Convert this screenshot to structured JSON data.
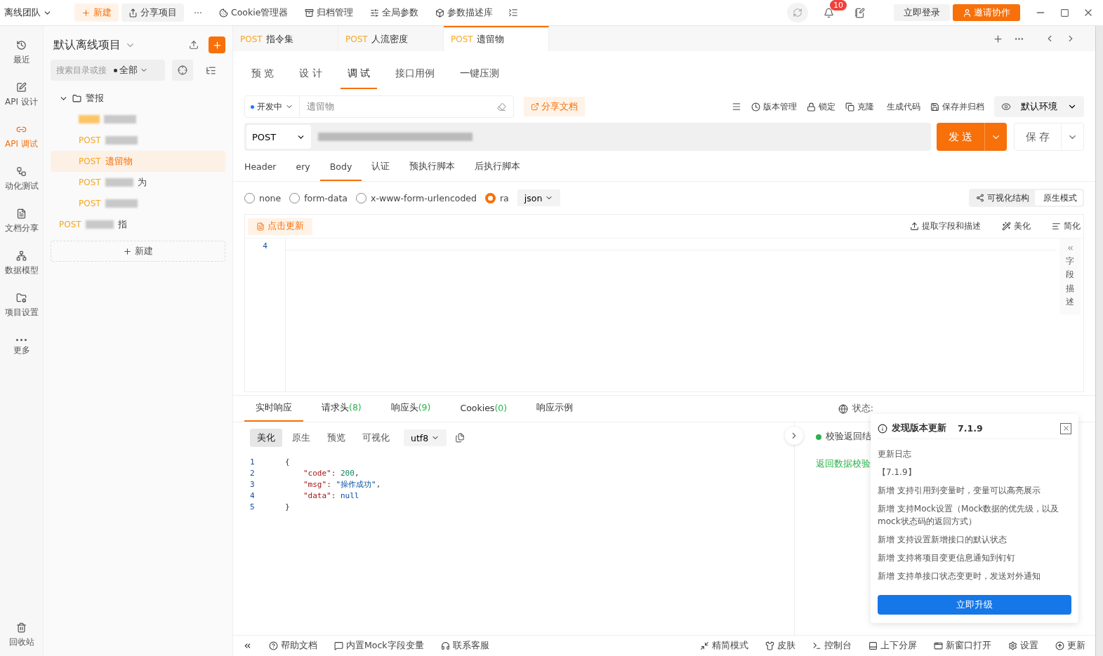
{
  "top_bar": {
    "team": "离线团队",
    "actions": [
      {
        "label": "新建",
        "kind": "primary"
      },
      {
        "label": "分享项目",
        "kind": "boxed"
      },
      {
        "label": "···",
        "kind": "plain"
      },
      {
        "label": "Cookie管理器",
        "kind": "plain"
      },
      {
        "label": "归档管理",
        "kind": "plain"
      },
      {
        "label": "全局参数",
        "kind": "plain"
      },
      {
        "label": "参数描述库",
        "kind": "plain"
      }
    ],
    "notification_count": "10",
    "login": "立即登录",
    "invite": "邀请协作"
  },
  "rail": {
    "items": [
      {
        "label": "最近",
        "selected": false
      },
      {
        "label": "API 设计",
        "selected": false
      },
      {
        "label": "API 调试",
        "selected": true
      },
      {
        "label": "动化测试",
        "selected": false
      },
      {
        "label": "文档分享",
        "selected": false
      },
      {
        "label": "数据模型",
        "selected": false
      },
      {
        "label": "项目设置",
        "selected": false
      },
      {
        "label": "更多",
        "selected": false
      }
    ],
    "bottom": "回收站"
  },
  "sidebar": {
    "title": "默认离线项目",
    "search_placeholder": "搜索目录或接",
    "filter": "全部",
    "tree": [
      {
        "name": "警报",
        "kind": "folder",
        "expanded": true,
        "children": [
          {
            "kind": "api",
            "blurred": true,
            "selected": false
          },
          {
            "kind": "api",
            "method": "POST",
            "blurred": true,
            "selected": false
          },
          {
            "kind": "api",
            "method": "POST",
            "name": "遗留物",
            "blurred": false,
            "selected": true
          },
          {
            "kind": "api",
            "method": "POST",
            "name": "为",
            "blurred": true,
            "selected": false
          },
          {
            "kind": "api",
            "method": "POST",
            "blurred": true,
            "selected": false
          }
        ]
      },
      {
        "kind": "api",
        "method": "POST",
        "name": "指",
        "blurred": true,
        "selected": false
      }
    ],
    "new_label": "新建"
  },
  "doc_tabs": [
    {
      "method": "POST",
      "name": "指令集",
      "selected": false
    },
    {
      "method": "POST",
      "name": "人流密度",
      "selected": false
    },
    {
      "method": "POST",
      "name": "遗留物",
      "selected": true
    }
  ],
  "view_tabs": [
    {
      "label": "预 览",
      "selected": false
    },
    {
      "label": "设 计",
      "selected": false
    },
    {
      "label": "调 试",
      "selected": true
    },
    {
      "label": "接口用例",
      "selected": false
    },
    {
      "label": "一键压测",
      "selected": false
    }
  ],
  "toolbar": {
    "status": "开发中",
    "name": "遗留物",
    "share": "分享文档",
    "actions": [
      "版本管理",
      "锁定",
      "克隆",
      "生成代码",
      "保存并归档"
    ],
    "environment": "默认环境"
  },
  "request": {
    "method": "POST",
    "send": "发 送",
    "save": "保 存",
    "tabs": [
      {
        "label": "Header",
        "selected": false
      },
      {
        "label": "ery",
        "selected": false
      },
      {
        "label": "Body",
        "selected": true
      },
      {
        "label": "认证",
        "selected": false
      },
      {
        "label": "预执行脚本",
        "selected": false
      },
      {
        "label": "后执行脚本",
        "selected": false
      }
    ],
    "body_types": [
      {
        "label": "none",
        "selected": false
      },
      {
        "label": "form-data",
        "selected": false
      },
      {
        "label": "x-www-form-urlencoded",
        "selected": false
      },
      {
        "label": "ra",
        "selected": true
      }
    ],
    "format": "json",
    "modes": [
      {
        "label": "可视化结构",
        "selected": false
      },
      {
        "label": "原生模式",
        "selected": true
      }
    ],
    "update": "点击更新",
    "editor_actions": [
      "提取字段和描述",
      "美化",
      "简化"
    ],
    "line_number": "4",
    "field_panel": "字段描述"
  },
  "response": {
    "tabs": [
      {
        "label": "实时响应",
        "selected": true
      },
      {
        "label": "请求头",
        "count": "(8)",
        "selected": false
      },
      {
        "label": "响应头",
        "count": "(9)",
        "selected": false
      },
      {
        "label": "Cookies",
        "count": "(0)",
        "selected": false
      },
      {
        "label": "响应示例",
        "selected": false
      }
    ],
    "status_label": "状态:",
    "views": [
      {
        "label": "美化",
        "selected": true
      },
      {
        "label": "原生",
        "selected": false
      },
      {
        "label": "预览",
        "selected": false
      },
      {
        "label": "可视化",
        "selected": false
      }
    ],
    "encoding": "utf8",
    "lines": [
      {
        "number": "1",
        "indented": false,
        "tokens": [
          {
            "kind": "punct",
            "text": "{"
          }
        ]
      },
      {
        "number": "2",
        "indented": true,
        "tokens": [
          {
            "kind": "key",
            "text": "\"code\""
          },
          {
            "kind": "punct",
            "text": ": "
          },
          {
            "kind": "number",
            "text": "200"
          },
          {
            "kind": "punct",
            "text": ","
          }
        ]
      },
      {
        "number": "3",
        "indented": true,
        "tokens": [
          {
            "kind": "key",
            "text": "\"msg\""
          },
          {
            "kind": "punct",
            "text": ": "
          },
          {
            "kind": "string",
            "text": "\"操作成功\""
          },
          {
            "kind": "punct",
            "text": ","
          }
        ]
      },
      {
        "number": "4",
        "indented": true,
        "tokens": [
          {
            "kind": "key",
            "text": "\"data\""
          },
          {
            "kind": "punct",
            "text": ": "
          },
          {
            "kind": "null",
            "text": "null"
          }
        ]
      },
      {
        "number": "5",
        "indented": false,
        "tokens": [
          {
            "kind": "punct",
            "text": "}"
          }
        ]
      }
    ],
    "check_title": "校验返回结",
    "check_result": "返回数据校验"
  },
  "update_popup": {
    "title": "发现版本更新",
    "version": "7.1.9",
    "log_title": "更新日志",
    "release": "【7.1.9】",
    "entries": [
      "新增 支持引用到变量时，变量可以高亮展示",
      "新增 支持Mock设置（Mock数据的优先级，以及mock状态码的返回方式）",
      "新增 支持设置新增接口的默认状态",
      "新增 支持将项目变更信息通知到钉钉",
      "新增 支持单接口状态变更时，发送对外通知"
    ],
    "button": "立即升级"
  },
  "status_bar": {
    "left": [
      "帮助文档",
      "内置Mock字段变量",
      "联系客服"
    ],
    "right": [
      "精简模式",
      "皮肤",
      "控制台",
      "上下分屏",
      "新窗口打开",
      "设置",
      "更新"
    ]
  }
}
